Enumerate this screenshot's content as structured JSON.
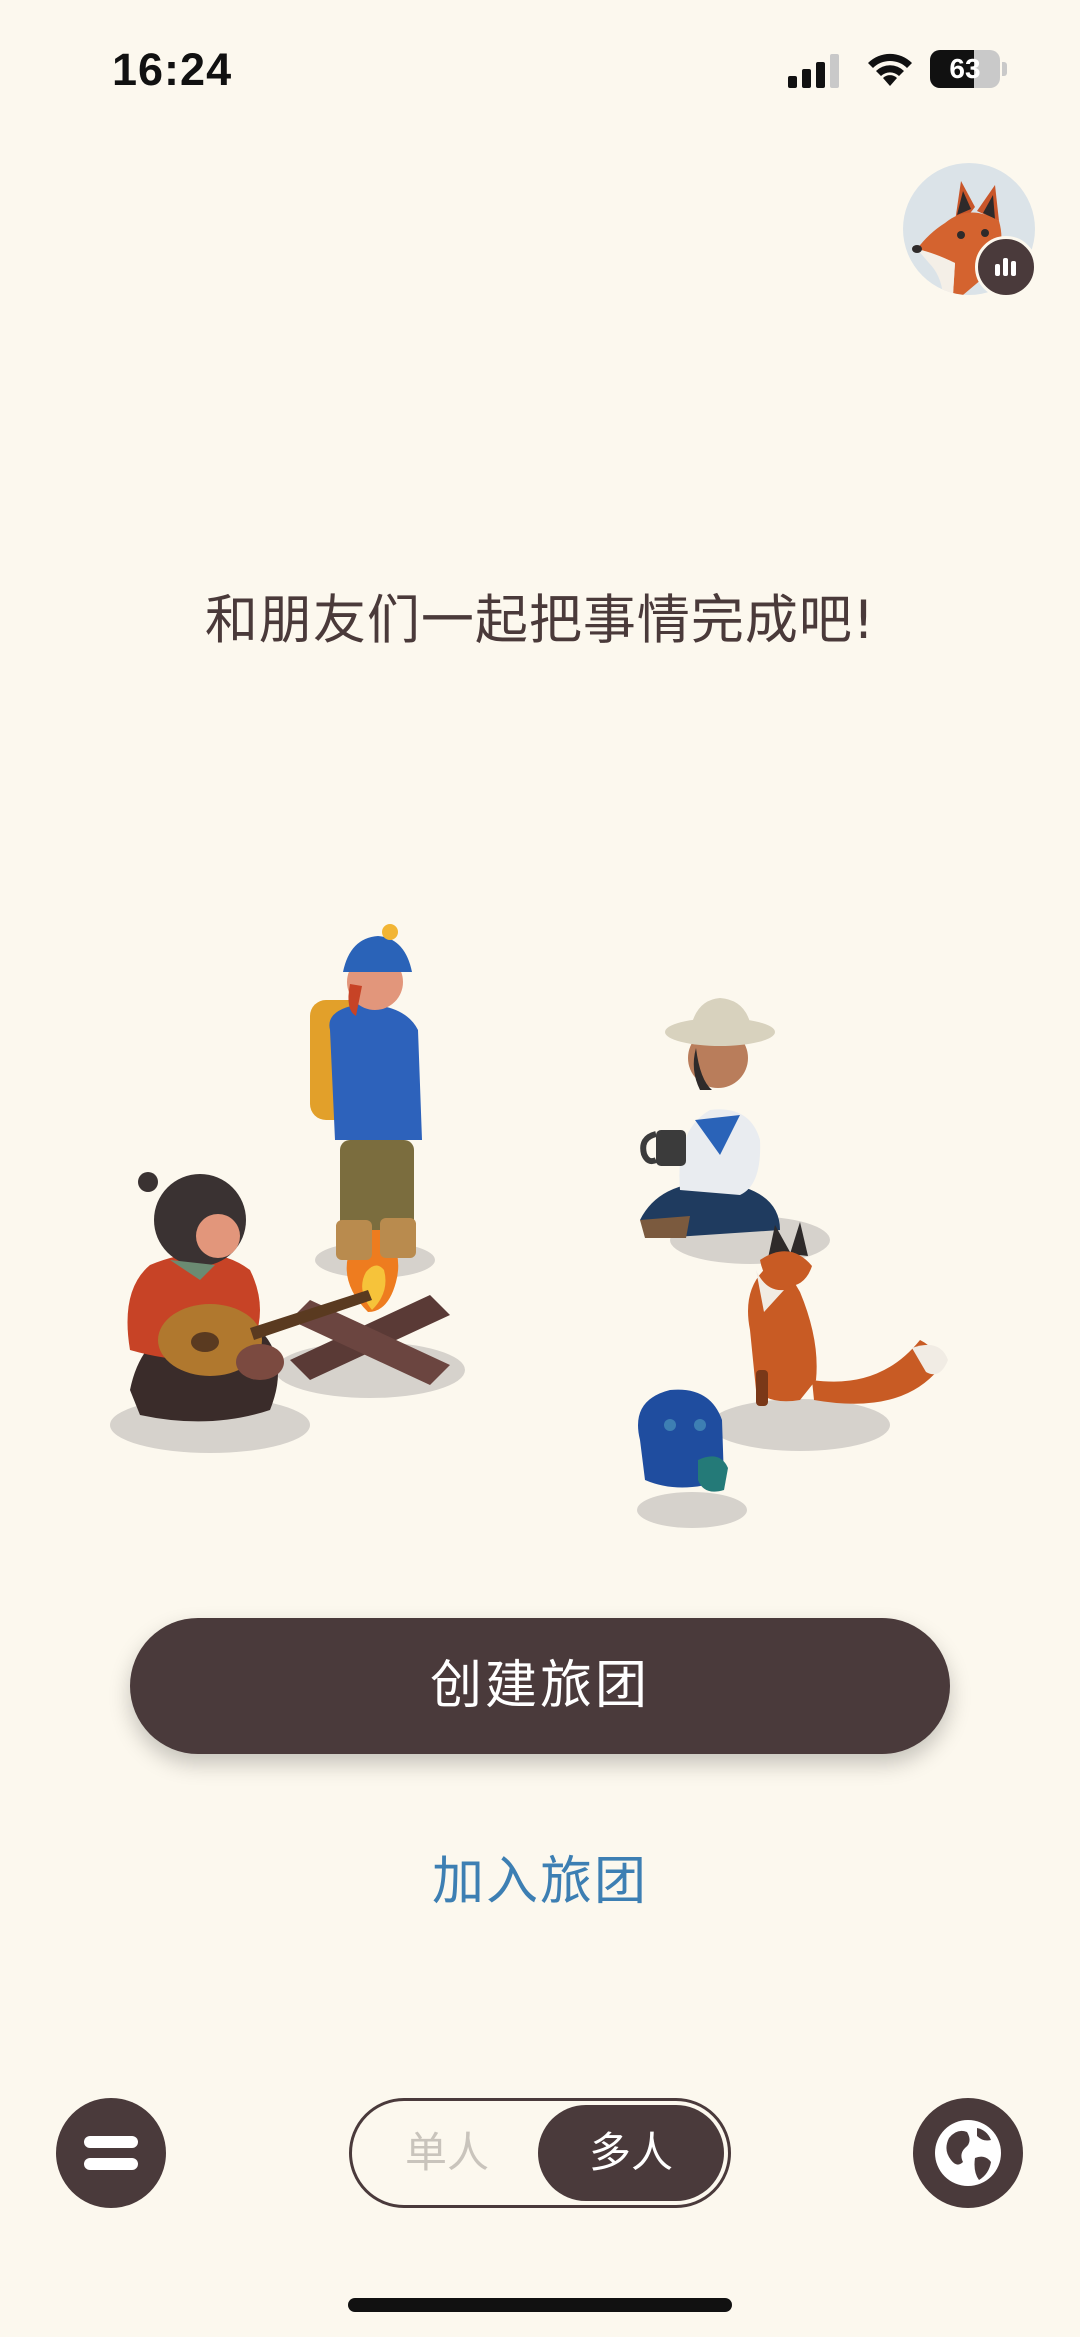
{
  "status_bar": {
    "time": "16:24",
    "battery_level": "63",
    "battery_fraction": 0.63,
    "icons": [
      "signal-icon",
      "wifi-icon",
      "battery-icon"
    ]
  },
  "profile": {
    "avatar": "fox-avatar",
    "badge_icon": "bar-chart-icon"
  },
  "headline": "和朋友们一起把事情完成吧!",
  "illustration": "campfire-scene",
  "actions": {
    "create_label": "创建旅团",
    "join_label": "加入旅团"
  },
  "bottom_bar": {
    "menu_icon": "menu-icon",
    "mode_single": "单人",
    "mode_multi": "多人",
    "selected_mode": "多人",
    "globe_icon": "globe-icon"
  },
  "colors": {
    "background": "#fcf8ee",
    "primary_dark": "#4a3a3b",
    "link_blue": "#3d7fb3",
    "inactive_text": "#c9c4bc"
  }
}
